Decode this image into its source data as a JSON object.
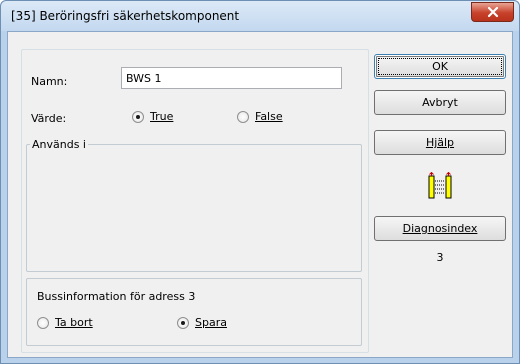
{
  "window": {
    "title": "[35] Beröringsfri säkerhetskomponent"
  },
  "form": {
    "name_label": "Namn:",
    "name_value": "BWS 1",
    "value_label": "Värde:",
    "radio_true": "True",
    "radio_false": "False",
    "selected_value": "True",
    "used_in_label": "Används i"
  },
  "bus": {
    "title": "Bussinformation för adress 3",
    "remove_label": "Ta bort",
    "save_label": "Spara",
    "selected": "Spara"
  },
  "buttons": {
    "ok": "OK",
    "cancel": "Avbryt",
    "help": "Hjälp",
    "diagnostics": "Diagnosindex"
  },
  "diagnostics_value": "3",
  "colors": {
    "status_icon_yellow": "#ffff00"
  }
}
